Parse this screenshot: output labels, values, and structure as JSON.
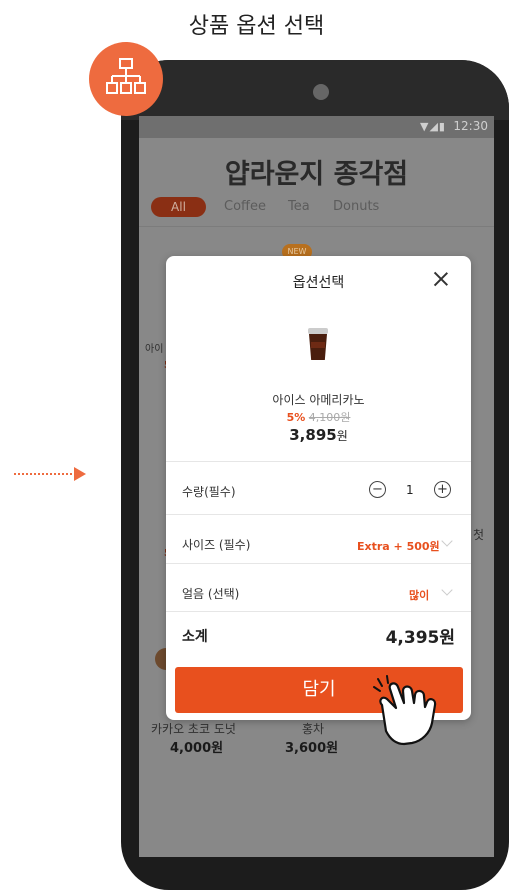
{
  "page_title": "상품 옵션 선택",
  "status_bar": {
    "icons": "▼◢▮",
    "time": "12:30"
  },
  "store": {
    "title": "얍라운지 종각점",
    "tabs": [
      {
        "label": "All",
        "active": true
      },
      {
        "label": "Coffee"
      },
      {
        "label": "Tea"
      },
      {
        "label": "Donuts"
      }
    ],
    "new_badge": "NEW",
    "background_items": [
      {
        "name": "카카오 초코 도넛",
        "price": "4,000원"
      },
      {
        "name": "홍차",
        "price": "3,600원"
      }
    ],
    "partial_texts": {
      "left_name": "아이",
      "left_discount": "5",
      "left_discount_2": "5",
      "right_frag": "첫"
    }
  },
  "modal": {
    "title": "옵션선택",
    "product": {
      "name": "아이스 아메리카노",
      "discount": "5%",
      "original_price": "4,100원",
      "price": "3,895",
      "price_unit": "원"
    },
    "quantity": {
      "label": "수량(필수)",
      "minus": "−",
      "value": "1",
      "plus": "+"
    },
    "size": {
      "label": "사이즈 (필수)",
      "value": "Extra + 500원"
    },
    "ice": {
      "label": "얼음 (선택)",
      "value": "많이"
    },
    "subtotal": {
      "label": "소계",
      "value": "4,395원"
    }
  },
  "add_button_label": "담기",
  "colors": {
    "accent": "#e8501e",
    "badge": "#ee6b3f"
  },
  "icons": {
    "badge": "sitemap-icon",
    "close": "close-icon",
    "pointer": "hand-pointer-icon"
  }
}
